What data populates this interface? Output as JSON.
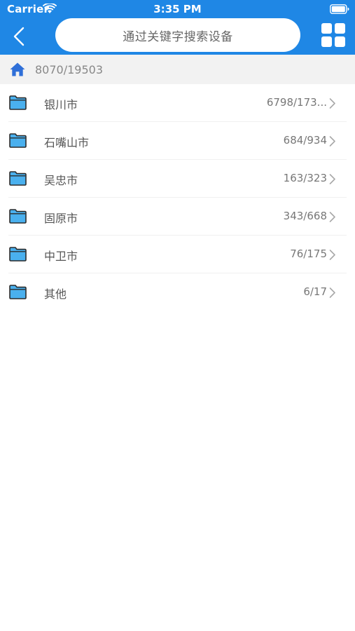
{
  "status_bar": {
    "carrier": "Carrier",
    "time": "3:35 PM",
    "wifi_icon": "wifi-icon",
    "battery_icon": "battery-icon"
  },
  "header": {
    "back_icon": "chevron-left-icon",
    "search": {
      "placeholder": "通过关键字搜索设备"
    },
    "grid_icon": "grid-icon",
    "background_color": "#1f87e5"
  },
  "breadcrumb": {
    "home_icon": "home-icon",
    "home_icon_color": "#2f6fd8",
    "text": "8070/19503"
  },
  "list": {
    "item_icon": "folder-icon",
    "folder_color": "#4ab0ee",
    "items": [
      {
        "name": "银川市",
        "count": "6798/173..."
      },
      {
        "name": "石嘴山市",
        "count": "684/934"
      },
      {
        "name": "吴忠市",
        "count": "163/323"
      },
      {
        "name": "固原市",
        "count": "343/668"
      },
      {
        "name": "中卫市",
        "count": "76/175"
      },
      {
        "name": "其他",
        "count": "6/17"
      }
    ]
  }
}
